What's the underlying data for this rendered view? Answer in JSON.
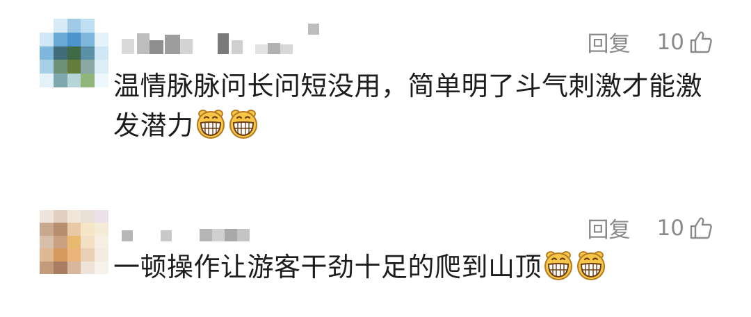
{
  "comments": [
    {
      "reply_label": "回复",
      "like_count": "10",
      "text": "温情脉脉问长问短没用，简单明了斗气刺激才能激发潜力",
      "emojis": [
        "grin-emoji",
        "grin-emoji"
      ]
    },
    {
      "reply_label": "回复",
      "like_count": "10",
      "text": "一顿操作让游客干劲十足的爬到山顶",
      "emojis": [
        "grin-emoji",
        "grin-emoji"
      ]
    }
  ],
  "icons": {
    "like": "thumbs-up-icon",
    "emoji": "grin-emoji"
  },
  "colors": {
    "muted": "#8a8a8a",
    "text": "#1c1c1c",
    "background": "#ffffff",
    "emoji_face": "#f7c547"
  }
}
